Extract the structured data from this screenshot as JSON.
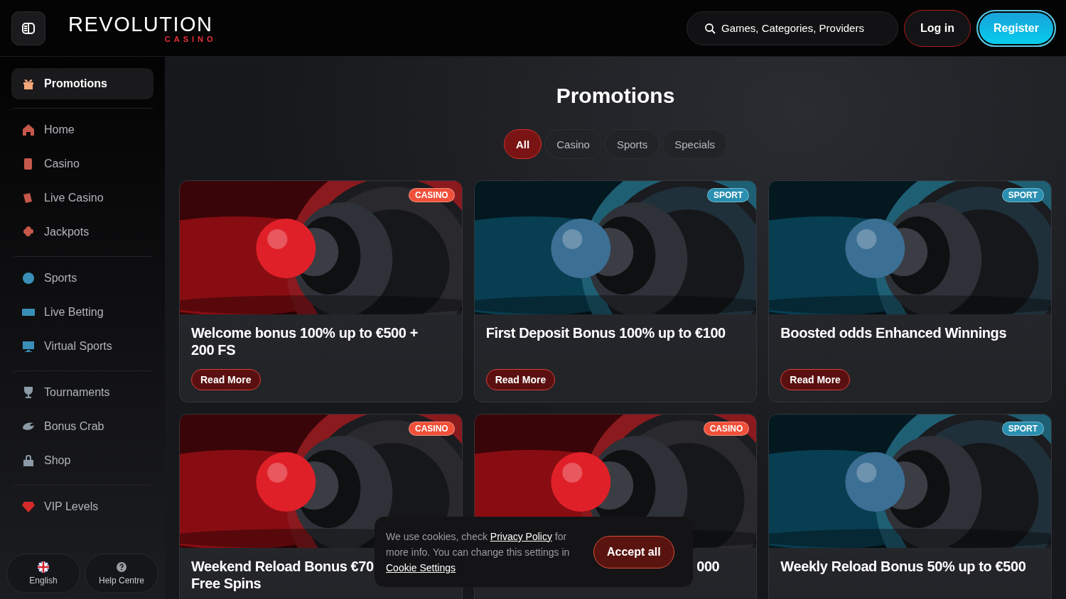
{
  "header": {
    "logo_main": "REVOLUTION",
    "logo_sub": "CASINO",
    "search": {
      "placeholder": "Games, Categories, Providers"
    },
    "login": "Log in",
    "register": "Register"
  },
  "sidebar": {
    "groups": [
      {
        "items": [
          {
            "label": "Promotions",
            "selected": true
          }
        ]
      },
      {
        "items": [
          {
            "label": "Home",
            "selected": false
          },
          {
            "label": "Casino",
            "selected": false
          },
          {
            "label": "Live Casino",
            "selected": false
          },
          {
            "label": "Jackpots",
            "selected": false
          }
        ]
      },
      {
        "items": [
          {
            "label": "Sports",
            "selected": false
          },
          {
            "label": "Live Betting",
            "selected": false
          },
          {
            "label": "Virtual Sports",
            "selected": false
          }
        ]
      },
      {
        "items": [
          {
            "label": "Tournaments",
            "selected": false
          },
          {
            "label": "Bonus Crab",
            "selected": false
          },
          {
            "label": "Shop",
            "selected": false
          }
        ]
      },
      {
        "items": [
          {
            "label": "VIP Levels",
            "selected": false
          }
        ]
      }
    ],
    "footer": [
      {
        "kind": "language",
        "label": "English"
      },
      {
        "kind": "help",
        "label": "Help Centre"
      }
    ]
  },
  "page_title": "Promotions",
  "filters": [
    {
      "label": "All",
      "selected": true
    },
    {
      "label": "Casino",
      "selected": false
    },
    {
      "label": "Sports",
      "selected": false
    },
    {
      "label": "Specials",
      "selected": false
    }
  ],
  "cards": [
    {
      "kind": "casino",
      "badge": "CASINO",
      "title_lines": [
        "Welcome bonus 100% up to €500 +",
        "200 FS"
      ],
      "button": "Read More",
      "title_covered": false
    },
    {
      "kind": "sport",
      "badge": "SPORT",
      "title_lines": [
        "First Deposit Bonus 100% up to €100"
      ],
      "button": "Read More",
      "title_covered": false
    },
    {
      "kind": "sport",
      "badge": "SPORT",
      "title_lines": [
        "Boosted odds Enhanced Winnings"
      ],
      "button": "Read More",
      "title_covered": false
    },
    {
      "kind": "casino",
      "badge": "CASINO",
      "title_lines": [
        "Weekend Reload Bonus €70",
        "Free Spins"
      ],
      "title_covered": false
    },
    {
      "kind": "casino",
      "badge": "CASINO",
      "title_lines": [
        "000"
      ],
      "title_covered": true
    },
    {
      "kind": "sport",
      "badge": "SPORT",
      "title_lines": [
        "Weekly Reload Bonus 50% up to €500"
      ],
      "title_covered": false
    }
  ],
  "cookie_banner": {
    "text_before": "We use cookies, check",
    "privacy_link": "Privacy Policy",
    "text_middle": "for more info. You can change this settings in",
    "settings_link": "Cookie Settings",
    "accept": "Accept all"
  }
}
